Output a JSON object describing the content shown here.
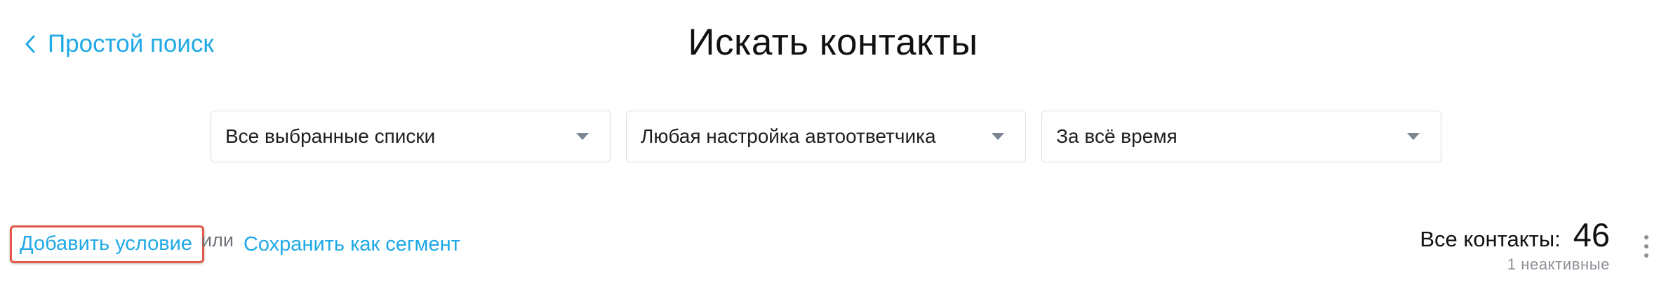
{
  "header": {
    "back_label": "Простой поиск",
    "title": "Искать контакты"
  },
  "filters": [
    {
      "value": "Все выбранные списки"
    },
    {
      "value": "Любая настройка автоответчика"
    },
    {
      "value": "За всё время"
    }
  ],
  "actions": {
    "add_condition": "Добавить условие",
    "or": "или",
    "save_segment": "Сохранить как сегмент"
  },
  "contacts": {
    "label": "Все контакты:",
    "count": "46",
    "inactive": "1 неактивные"
  },
  "icons": {
    "back": "chevron-left-icon",
    "dropdown": "caret-down-icon",
    "menu": "more-vertical-icon"
  },
  "colors": {
    "accent": "#1fa9e5",
    "highlight": "#e2574a"
  }
}
